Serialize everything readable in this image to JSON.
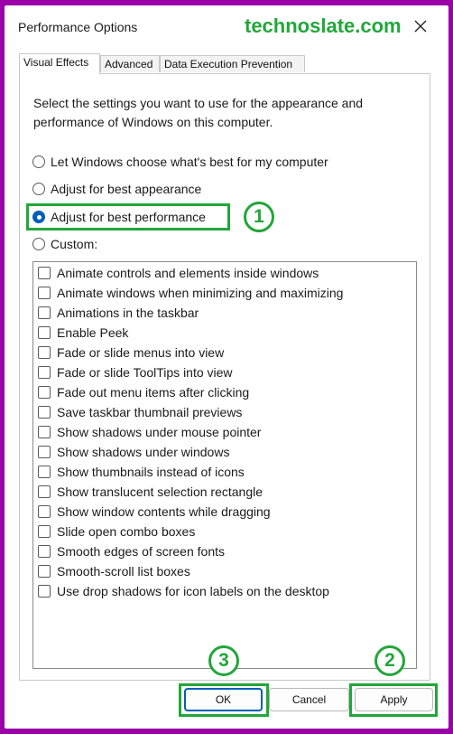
{
  "window": {
    "title": "Performance Options",
    "watermark": "technoslate.com"
  },
  "tabs": [
    {
      "label": "Visual Effects",
      "active": true
    },
    {
      "label": "Advanced",
      "active": false
    },
    {
      "label": "Data Execution Prevention",
      "active": false
    }
  ],
  "description": "Select the settings you want to use for the appearance and performance of Windows on this computer.",
  "radios": [
    {
      "label": "Let Windows choose what's best for my computer",
      "checked": false
    },
    {
      "label": "Adjust for best appearance",
      "checked": false
    },
    {
      "label": "Adjust for best performance",
      "checked": true
    },
    {
      "label": "Custom:",
      "checked": false
    }
  ],
  "effects": [
    "Animate controls and elements inside windows",
    "Animate windows when minimizing and maximizing",
    "Animations in the taskbar",
    "Enable Peek",
    "Fade or slide menus into view",
    "Fade or slide ToolTips into view",
    "Fade out menu items after clicking",
    "Save taskbar thumbnail previews",
    "Show shadows under mouse pointer",
    "Show shadows under windows",
    "Show thumbnails instead of icons",
    "Show translucent selection rectangle",
    "Show window contents while dragging",
    "Slide open combo boxes",
    "Smooth edges of screen fonts",
    "Smooth-scroll list boxes",
    "Use drop shadows for icon labels on the desktop"
  ],
  "buttons": {
    "ok": "OK",
    "cancel": "Cancel",
    "apply": "Apply"
  },
  "annotations": {
    "step1": "1",
    "step2": "2",
    "step3": "3"
  },
  "colors": {
    "accent": "#005fb8",
    "highlight": "#22a63a",
    "border": "#9b00a8"
  }
}
